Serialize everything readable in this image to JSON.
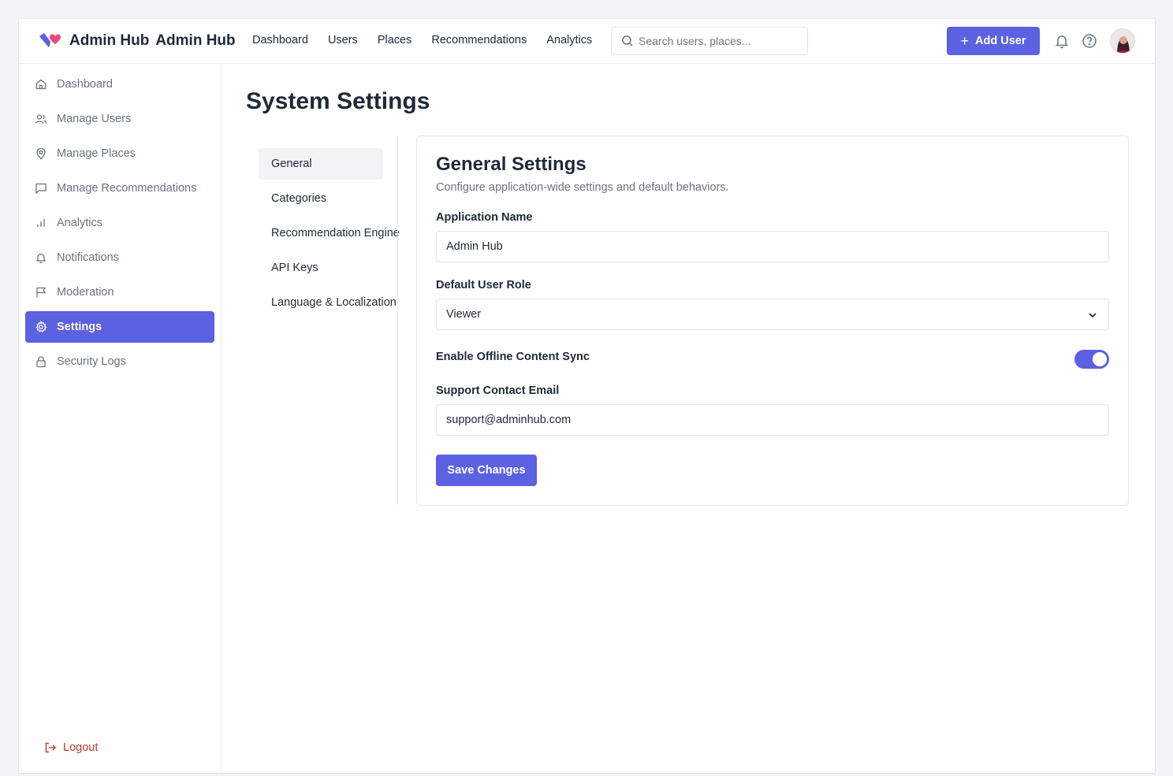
{
  "header": {
    "brand_primary": "Admin Hub",
    "brand_secondary": "Admin Hub",
    "nav": [
      "Dashboard",
      "Users",
      "Places",
      "Recommendations",
      "Analytics"
    ],
    "search_placeholder": "Search users, places...",
    "add_user_label": "Add User"
  },
  "sidebar": {
    "items": [
      {
        "label": "Dashboard",
        "icon": "home-icon"
      },
      {
        "label": "Manage Users",
        "icon": "users-icon"
      },
      {
        "label": "Manage Places",
        "icon": "map-pin-icon"
      },
      {
        "label": "Manage Recommendations",
        "icon": "message-square-icon"
      },
      {
        "label": "Analytics",
        "icon": "bar-chart-icon"
      },
      {
        "label": "Notifications",
        "icon": "bell-icon"
      },
      {
        "label": "Moderation",
        "icon": "flag-icon"
      },
      {
        "label": "Settings",
        "icon": "gear-icon",
        "active": true
      },
      {
        "label": "Security Logs",
        "icon": "lock-icon"
      }
    ],
    "logout_label": "Logout"
  },
  "page": {
    "title": "System Settings"
  },
  "settings_nav": {
    "items": [
      "General",
      "Categories",
      "Recommendation Engine",
      "API Keys",
      "Language & Localization"
    ],
    "active": "General"
  },
  "general": {
    "title": "General Settings",
    "subtitle": "Configure application-wide settings and default behaviors.",
    "app_name_label": "Application Name",
    "app_name_value": "Admin Hub",
    "default_role_label": "Default User Role",
    "default_role_value": "Viewer",
    "offline_sync_label": "Enable Offline Content Sync",
    "offline_sync_enabled": true,
    "support_email_label": "Support Contact Email",
    "support_email_value": "support@adminhub.com",
    "save_label": "Save Changes"
  },
  "colors": {
    "accent": "#5b61e0",
    "logout": "#c0392b",
    "logo_primary": "#5b61e0",
    "logo_secondary": "#e84a7a"
  }
}
